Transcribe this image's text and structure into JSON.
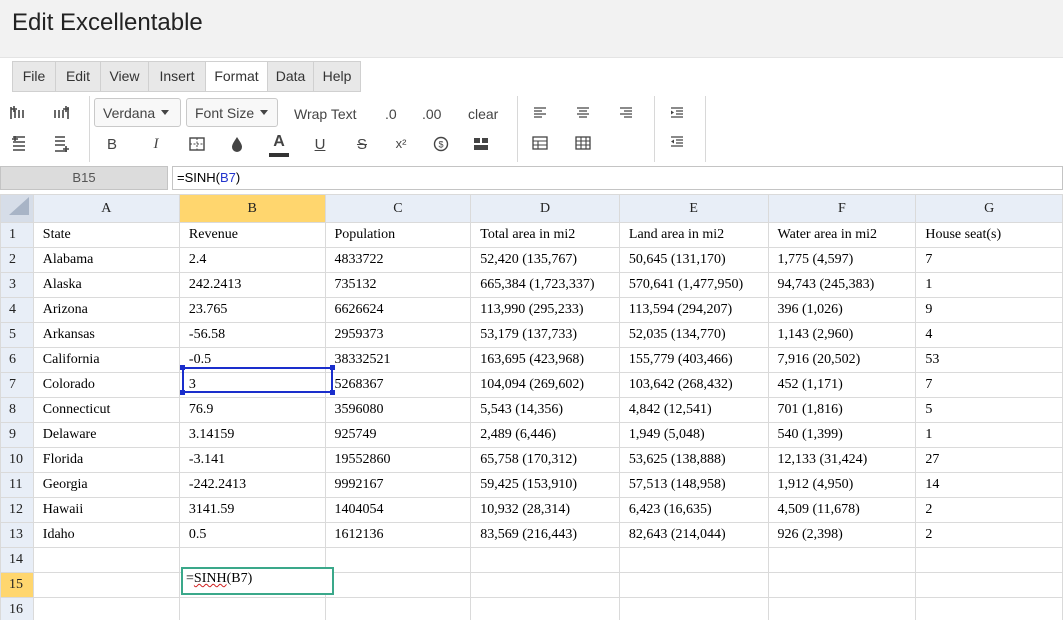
{
  "app": {
    "title": "Edit Excellentable"
  },
  "menu": [
    "File",
    "Edit",
    "View",
    "Insert",
    "Format",
    "Data",
    "Help"
  ],
  "menu_active": "Format",
  "toolbar": {
    "font_label": "Verdana",
    "font_size_label": "Font Size",
    "wrap_text_label": "Wrap Text",
    "dec_decrease_label": ".0",
    "dec_increase_label": ".00",
    "clear_label": "clear",
    "bold_label": "B",
    "italic_label": "I",
    "font_color_label": "A",
    "underline_label": "U",
    "strike_label": "S",
    "superscript_label": "x²"
  },
  "formula": {
    "cell_ref": "B15",
    "prefix": "=SINH(",
    "ref": "B7",
    "suffix": ")"
  },
  "columns": [
    "A",
    "B",
    "C",
    "D",
    "E",
    "F",
    "G"
  ],
  "selected_column": "B",
  "selected_row": "15",
  "rows": [
    [
      "1",
      "State",
      "Revenue",
      "Population",
      "Total area in mi2",
      "Land area in mi2",
      "Water area in mi2",
      "House seat(s)"
    ],
    [
      "2",
      "Alabama",
      "2.4",
      "4833722",
      "52,420 (135,767)",
      "50,645 (131,170)",
      "1,775 (4,597)",
      "7"
    ],
    [
      "3",
      "Alaska",
      "242.2413",
      "735132",
      "665,384 (1,723,337)",
      "570,641 (1,477,950)",
      "94,743 (245,383)",
      "1"
    ],
    [
      "4",
      "Arizona",
      "23.765",
      "6626624",
      "113,990 (295,233)",
      "113,594 (294,207)",
      "396 (1,026)",
      "9"
    ],
    [
      "5",
      "Arkansas",
      "-56.58",
      "2959373",
      "53,179 (137,733)",
      "52,035 (134,770)",
      "1,143 (2,960)",
      "4"
    ],
    [
      "6",
      "California",
      "-0.5",
      "38332521",
      "163,695 (423,968)",
      "155,779 (403,466)",
      "7,916 (20,502)",
      "53"
    ],
    [
      "7",
      "Colorado",
      "3",
      "5268367",
      "104,094 (269,602)",
      "103,642 (268,432)",
      "452 (1,171)",
      "7"
    ],
    [
      "8",
      "Connecticut",
      "76.9",
      "3596080",
      "5,543 (14,356)",
      "4,842 (12,541)",
      "701 (1,816)",
      "5"
    ],
    [
      "9",
      "Delaware",
      "3.14159",
      "925749",
      "2,489 (6,446)",
      "1,949 (5,048)",
      "540 (1,399)",
      "1"
    ],
    [
      "10",
      "Florida",
      "-3.141",
      "19552860",
      "65,758 (170,312)",
      "53,625 (138,888)",
      "12,133 (31,424)",
      "27"
    ],
    [
      "11",
      "Georgia",
      "-242.2413",
      "9992167",
      "59,425 (153,910)",
      "57,513 (148,958)",
      "1,912 (4,950)",
      "14"
    ],
    [
      "12",
      "Hawaii",
      "3141.59",
      "1404054",
      "10,932 (28,314)",
      "6,423 (16,635)",
      "4,509 (11,678)",
      "2"
    ],
    [
      "13",
      "Idaho",
      "0.5",
      "1612136",
      "83,569 (216,443)",
      "82,643 (214,044)",
      "926 (2,398)",
      "2"
    ],
    [
      "14",
      "",
      "",
      "",
      "",
      "",
      "",
      ""
    ],
    [
      "15",
      "",
      "",
      "",
      "",
      "",
      "",
      ""
    ],
    [
      "16",
      "",
      "",
      "",
      "",
      "",
      "",
      ""
    ]
  ],
  "edit_cell": {
    "text_prefix": "=",
    "text_main": "SINH",
    "text_rest": "(B7)"
  },
  "colors": {
    "selection": "#1a2ecc",
    "editing": "#3aa88a",
    "header_selected": "#ffd66e",
    "header": "#e8eef7"
  }
}
